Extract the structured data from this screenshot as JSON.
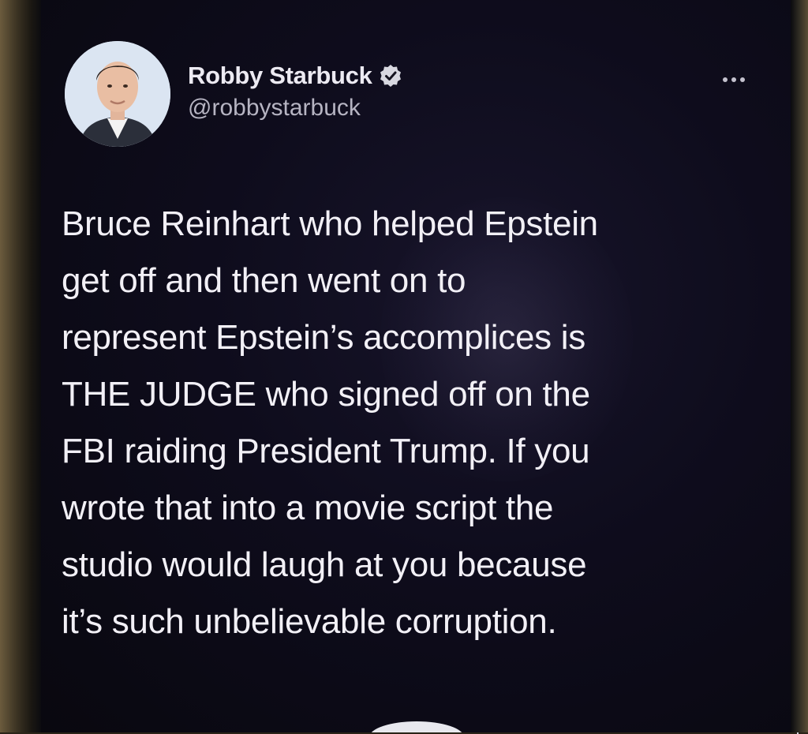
{
  "tweet": {
    "display_name": "Robby Starbuck",
    "handle": "@robbystarbuck",
    "verified": true,
    "text": "Bruce Reinhart who helped Epstein\nget off and then went on to\nrepresent Epstein’s accomplices is\nTHE JUDGE who signed off on the\nFBI raiding President Trump. If you\nwrote that into a movie script the\nstudio would laugh at you because\nit’s such unbelievable corruption."
  },
  "icons": {
    "verified": "verified-badge-icon",
    "more": "more-options-icon"
  },
  "colors": {
    "background": "#0e0c1c",
    "text": "#f2f0f6",
    "handle": "#b6b4c2"
  }
}
